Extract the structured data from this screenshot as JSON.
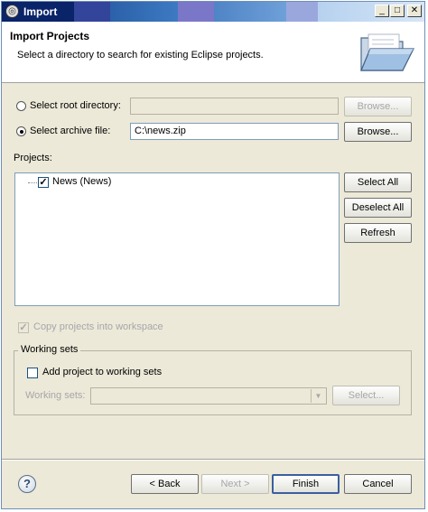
{
  "window": {
    "title": "Import",
    "min_label": "_",
    "max_label": "□",
    "close_label": "✕"
  },
  "header": {
    "title": "Import Projects",
    "description": "Select a directory to search for existing Eclipse projects."
  },
  "source": {
    "root_label": "Select root directory:",
    "root_value": "",
    "root_browse_label": "Browse...",
    "archive_label": "Select archive file:",
    "archive_value": "C:\\news.zip",
    "archive_browse_label": "Browse...",
    "selected": "archive"
  },
  "projects": {
    "label": "Projects:",
    "items": [
      {
        "label": "News (News)",
        "checked": true
      }
    ],
    "select_all_label": "Select All",
    "deselect_all_label": "Deselect All",
    "refresh_label": "Refresh"
  },
  "copy_into_workspace": {
    "label": "Copy projects into workspace",
    "checked": true,
    "enabled": false
  },
  "working_sets": {
    "legend": "Working sets",
    "add_label": "Add project to working sets",
    "add_checked": false,
    "field_label": "Working sets:",
    "field_value": "",
    "select_label": "Select..."
  },
  "footer": {
    "help_label": "?",
    "back_label": "< Back",
    "next_label": "Next >",
    "finish_label": "Finish",
    "cancel_label": "Cancel"
  },
  "icons": {
    "title_icon": "eclipse-icon",
    "folder_icon": "open-folder-icon",
    "help_icon": "help-icon"
  },
  "colors": {
    "title_start": "#0a246a",
    "title_end": "#d6e6f7",
    "field_border": "#7f9db9",
    "default_button_border": "#3a5fa0"
  }
}
